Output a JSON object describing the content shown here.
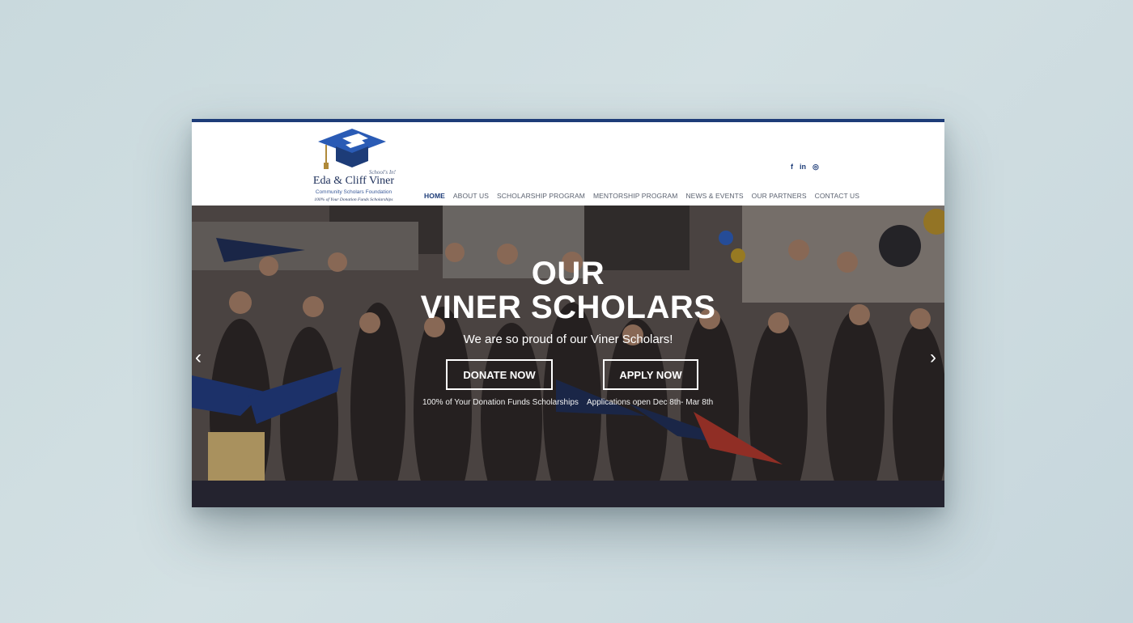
{
  "header": {
    "logo": {
      "tagline": "School's In!",
      "name": "Eda & Cliff Viner",
      "subtitle": "Community Scholars Foundation",
      "fund_note": "100% of Your Donation Funds Scholarships"
    },
    "social": [
      {
        "icon": "facebook-icon",
        "glyph": "f"
      },
      {
        "icon": "linkedin-icon",
        "glyph": "in"
      },
      {
        "icon": "instagram-icon",
        "glyph": "◎"
      }
    ],
    "nav": [
      {
        "label": "HOME",
        "active": true
      },
      {
        "label": "ABOUT US"
      },
      {
        "label": "SCHOLARSHIP PROGRAM"
      },
      {
        "label": "MENTORSHIP PROGRAM"
      },
      {
        "label": "NEWS & EVENTS"
      },
      {
        "label": "OUR PARTNERS"
      },
      {
        "label": "CONTACT US"
      }
    ]
  },
  "hero": {
    "title_line1": "OUR",
    "title_line2": "VINER SCHOLARS",
    "subtitle": "We are so proud of our Viner Scholars!",
    "donate_label": "DONATE NOW",
    "apply_label": "APPLY NOW",
    "donate_caption": "100% of Your Donation Funds Scholarships",
    "apply_caption": "Applications open Dec 8th- Mar 8th",
    "prev_glyph": "‹",
    "next_glyph": "›"
  },
  "colors": {
    "brand_navy": "#1d3c78",
    "nav_text": "#5b6270",
    "page_background": "#cfdde0"
  }
}
